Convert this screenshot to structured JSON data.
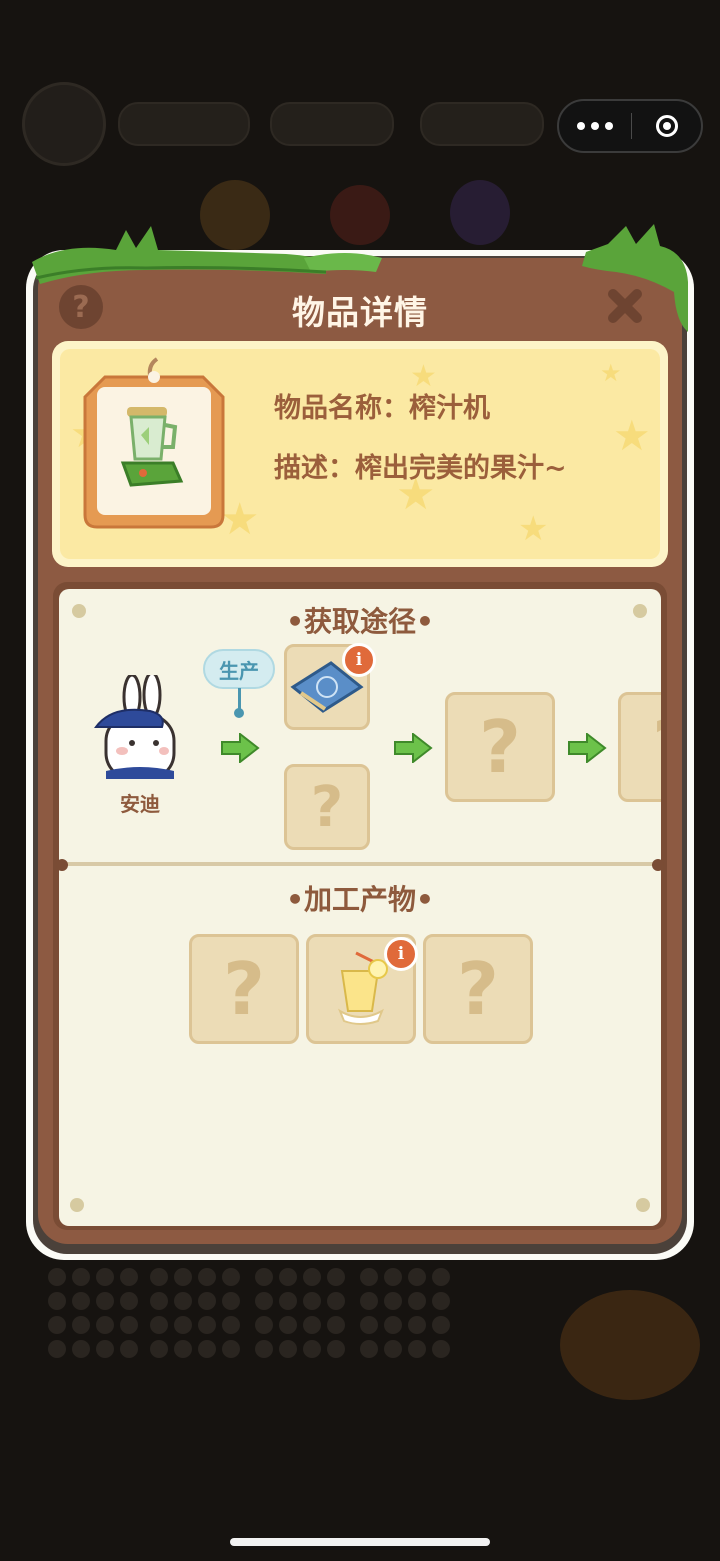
{
  "dialog": {
    "title": "物品详情",
    "help_icon": "question-icon",
    "close_icon": "close-x-icon"
  },
  "item": {
    "name_line": "物品名称：榨汁机",
    "desc_line": "描述：榨出完美的果汁~",
    "icon": "juicer-icon"
  },
  "acquire": {
    "title": "•获取途径•",
    "npc_name": "安迪",
    "bubble_label": "生产",
    "unknown_symbol": "?"
  },
  "products": {
    "title": "•加工产物•",
    "unknown_symbol": "?"
  },
  "colors": {
    "panel_brown": "#8d5a42",
    "grass_green": "#5aa43a",
    "arrow_green": "#6cc24a",
    "info_badge": "#e06a3a"
  }
}
